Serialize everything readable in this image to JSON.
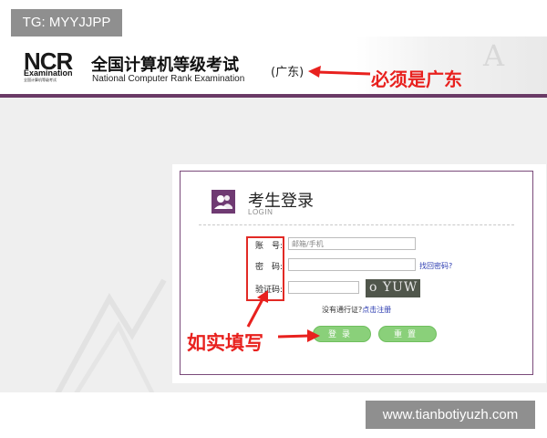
{
  "watermarks": {
    "tg": "TG: MYYJJPP",
    "site": "www.tianbotiyuzh.com"
  },
  "header": {
    "logo_letters": "NCR",
    "logo_word": "Examination",
    "logo_small": "全国计算机等级考试",
    "title": "全国计算机等级考试",
    "subtitle": "National Computer Rank Examination",
    "region": "(广东)"
  },
  "annotations": {
    "region_note": "必须是广东",
    "fill_note": "如实填写"
  },
  "login": {
    "title": "考生登录",
    "subtitle": "LOGIN",
    "account_label": "账　号:",
    "account_placeholder": "邮箱/手机",
    "password_label": "密　码:",
    "forgot_password": "找回密码?",
    "captcha_label": "验证码:",
    "captcha_text": "o YUW",
    "no_pass_text": "没有通行证?",
    "register_link": "点击注册",
    "login_button": "登录",
    "reset_button": "重置"
  },
  "colors": {
    "brand_purple": "#6a3a66",
    "annotation_red": "#e8211e",
    "button_green": "#8ad07a",
    "link_blue": "#2b3bb0"
  }
}
